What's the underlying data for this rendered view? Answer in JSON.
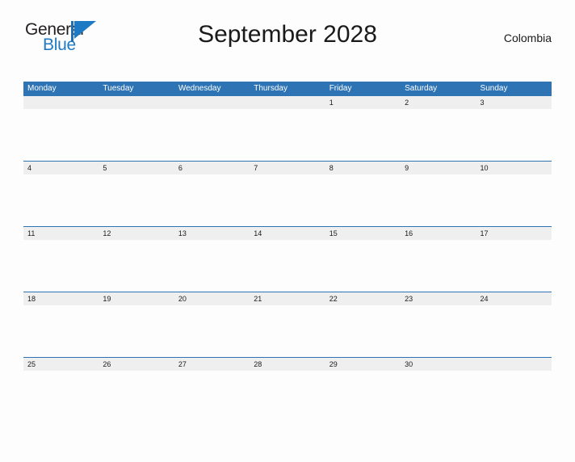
{
  "brand": {
    "name_part1": "General",
    "name_part2": "Blue",
    "flag_icon": "triangle-flag-icon",
    "color_dark": "#231f20",
    "color_blue": "#1f7ac4"
  },
  "header": {
    "title": "September 2028",
    "country": "Colombia"
  },
  "theme": {
    "header_blue": "#2e74b5",
    "date_band_gray": "#efefef",
    "page_background": "#fdfdfd",
    "text_dark": "#1a1a1a",
    "header_text": "#ffffff"
  },
  "calendar": {
    "weekdays": [
      "Monday",
      "Tuesday",
      "Wednesday",
      "Thursday",
      "Friday",
      "Saturday",
      "Sunday"
    ],
    "weeks": [
      [
        "",
        "",
        "",
        "",
        "1",
        "2",
        "3"
      ],
      [
        "4",
        "5",
        "6",
        "7",
        "8",
        "9",
        "10"
      ],
      [
        "11",
        "12",
        "13",
        "14",
        "15",
        "16",
        "17"
      ],
      [
        "18",
        "19",
        "20",
        "21",
        "22",
        "23",
        "24"
      ],
      [
        "25",
        "26",
        "27",
        "28",
        "29",
        "30",
        ""
      ]
    ]
  }
}
